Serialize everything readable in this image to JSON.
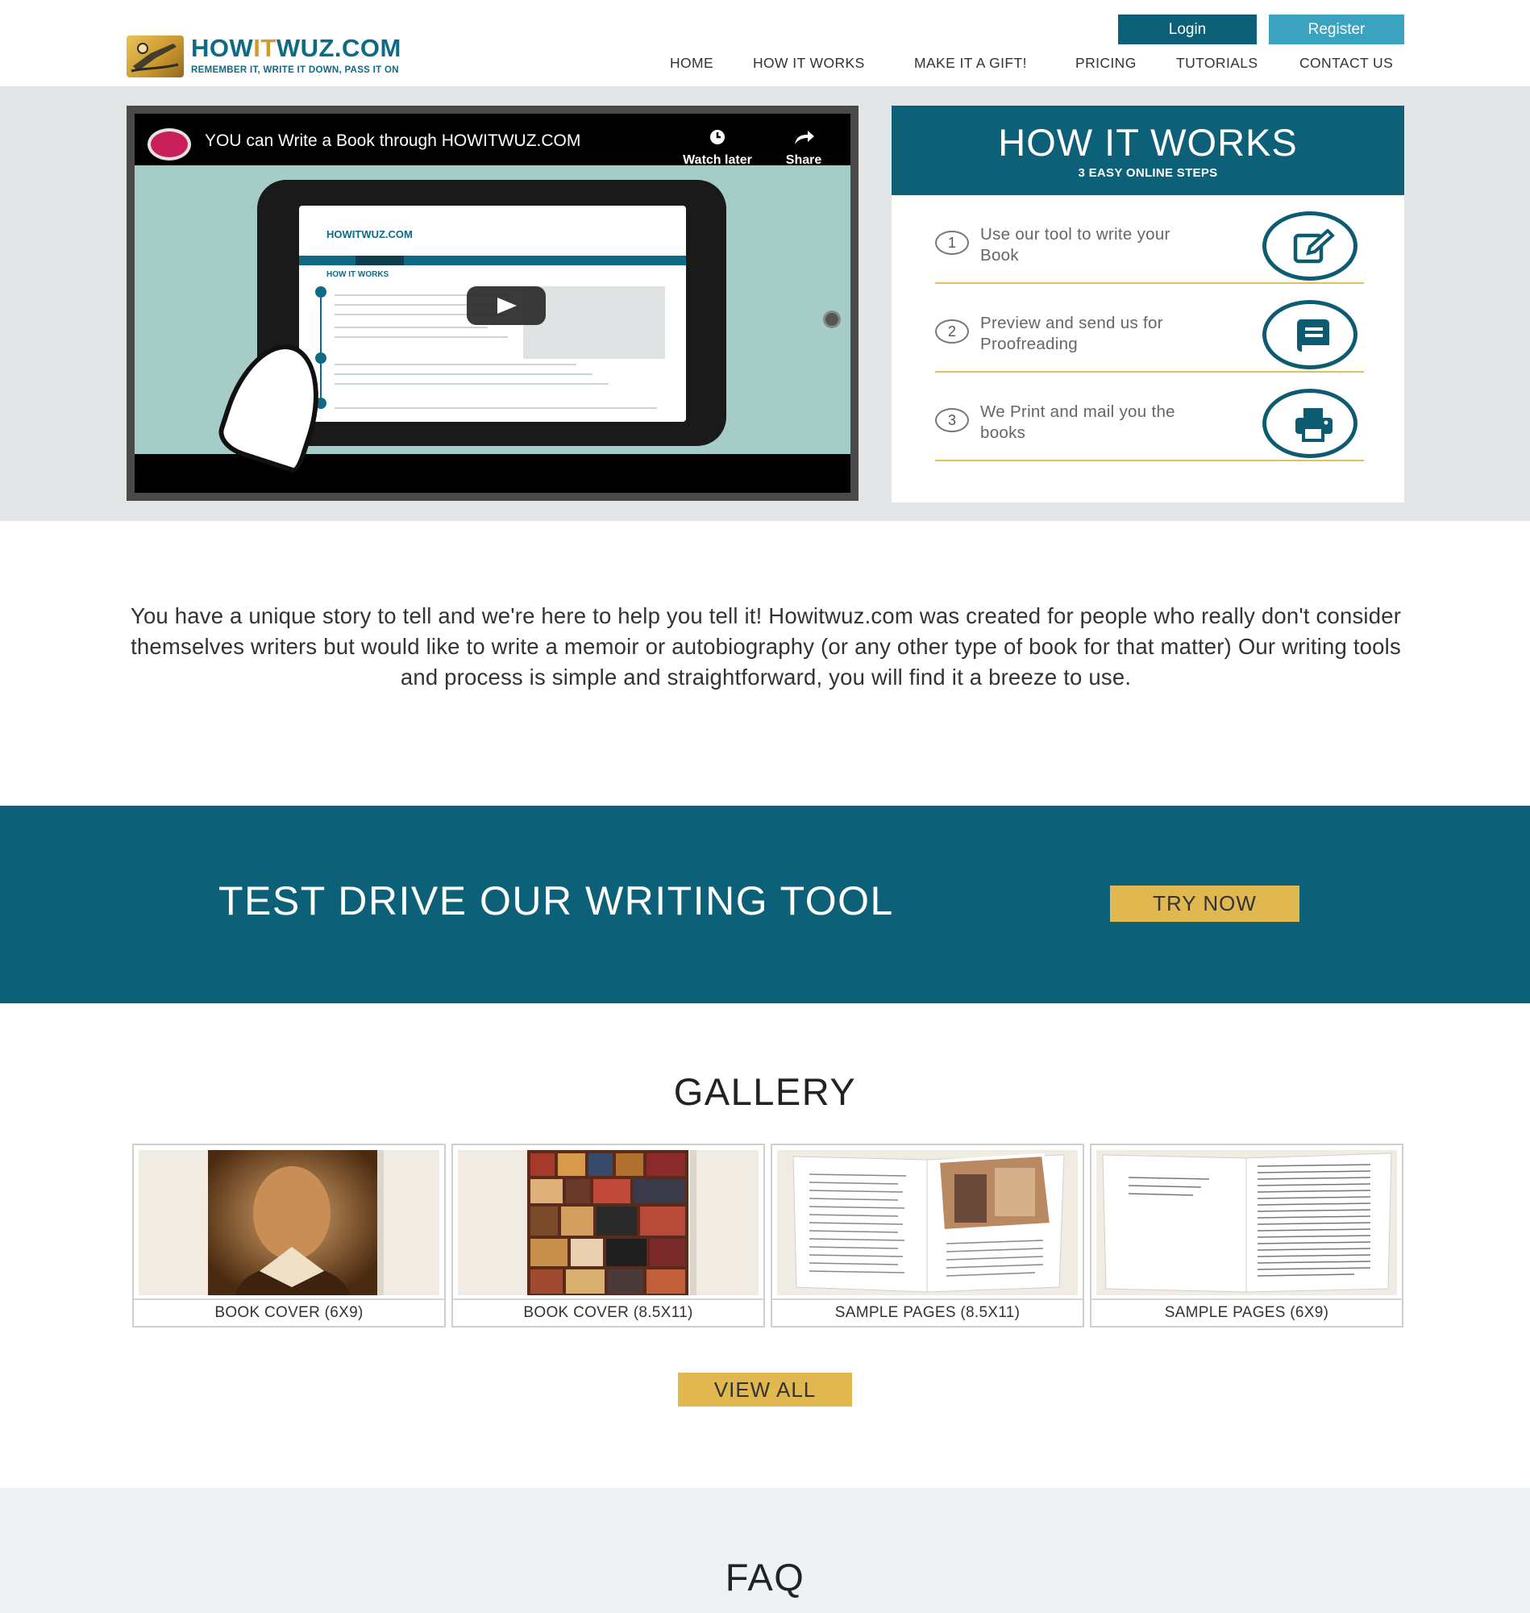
{
  "header": {
    "logo_title_a": "HOW",
    "logo_title_b": "IT",
    "logo_title_c": "WUZ.COM",
    "logo_tagline": "REMEMBER IT, WRITE IT DOWN, PASS IT ON",
    "login_label": "Login",
    "register_label": "Register",
    "nav": [
      "HOME",
      "HOW IT WORKS",
      "MAKE IT A GIFT!",
      "PRICING",
      "TUTORIALS",
      "CONTACT US"
    ]
  },
  "video": {
    "title": "YOU can Write a Book through HOWITWUZ.COM",
    "watch_later_label": "Watch later",
    "share_label": "Share",
    "screen_logo": "HOWITWUZ.COM",
    "screen_heading": "HOW IT WORKS"
  },
  "how_it_works": {
    "title": "HOW IT WORKS",
    "subtitle": "3 EASY ONLINE STEPS",
    "steps": [
      {
        "num": "1",
        "text": "Use our tool to write your Book",
        "icon": "edit-icon"
      },
      {
        "num": "2",
        "text": "Preview and send us for Proofreading",
        "icon": "book-icon"
      },
      {
        "num": "3",
        "text": "We Print and mail you the books",
        "icon": "printer-icon"
      }
    ]
  },
  "intro": {
    "text": "You have a unique story to tell and we're here to help you tell it! Howitwuz.com was created for people who really don't consider themselves writers but would like to write a memoir or autobiography (or any other type of book for that matter) Our writing tools and process is simple and straightforward, you will find it a breeze to use."
  },
  "cta": {
    "text": "TEST DRIVE OUR WRITING TOOL",
    "button_label": "TRY NOW"
  },
  "gallery": {
    "title": "GALLERY",
    "items": [
      {
        "caption": "BOOK COVER (6X9)"
      },
      {
        "caption": "BOOK COVER (8.5X11)"
      },
      {
        "caption": "SAMPLE PAGES (8.5X11)"
      },
      {
        "caption": "SAMPLE PAGES (6X9)"
      }
    ],
    "view_all_label": "VIEW ALL"
  },
  "faq": {
    "title": "FAQ"
  },
  "colors": {
    "primary": "#0c6179",
    "register": "#3ba3c0",
    "accent": "#e1b850",
    "step_rule": "#e1c15d"
  }
}
